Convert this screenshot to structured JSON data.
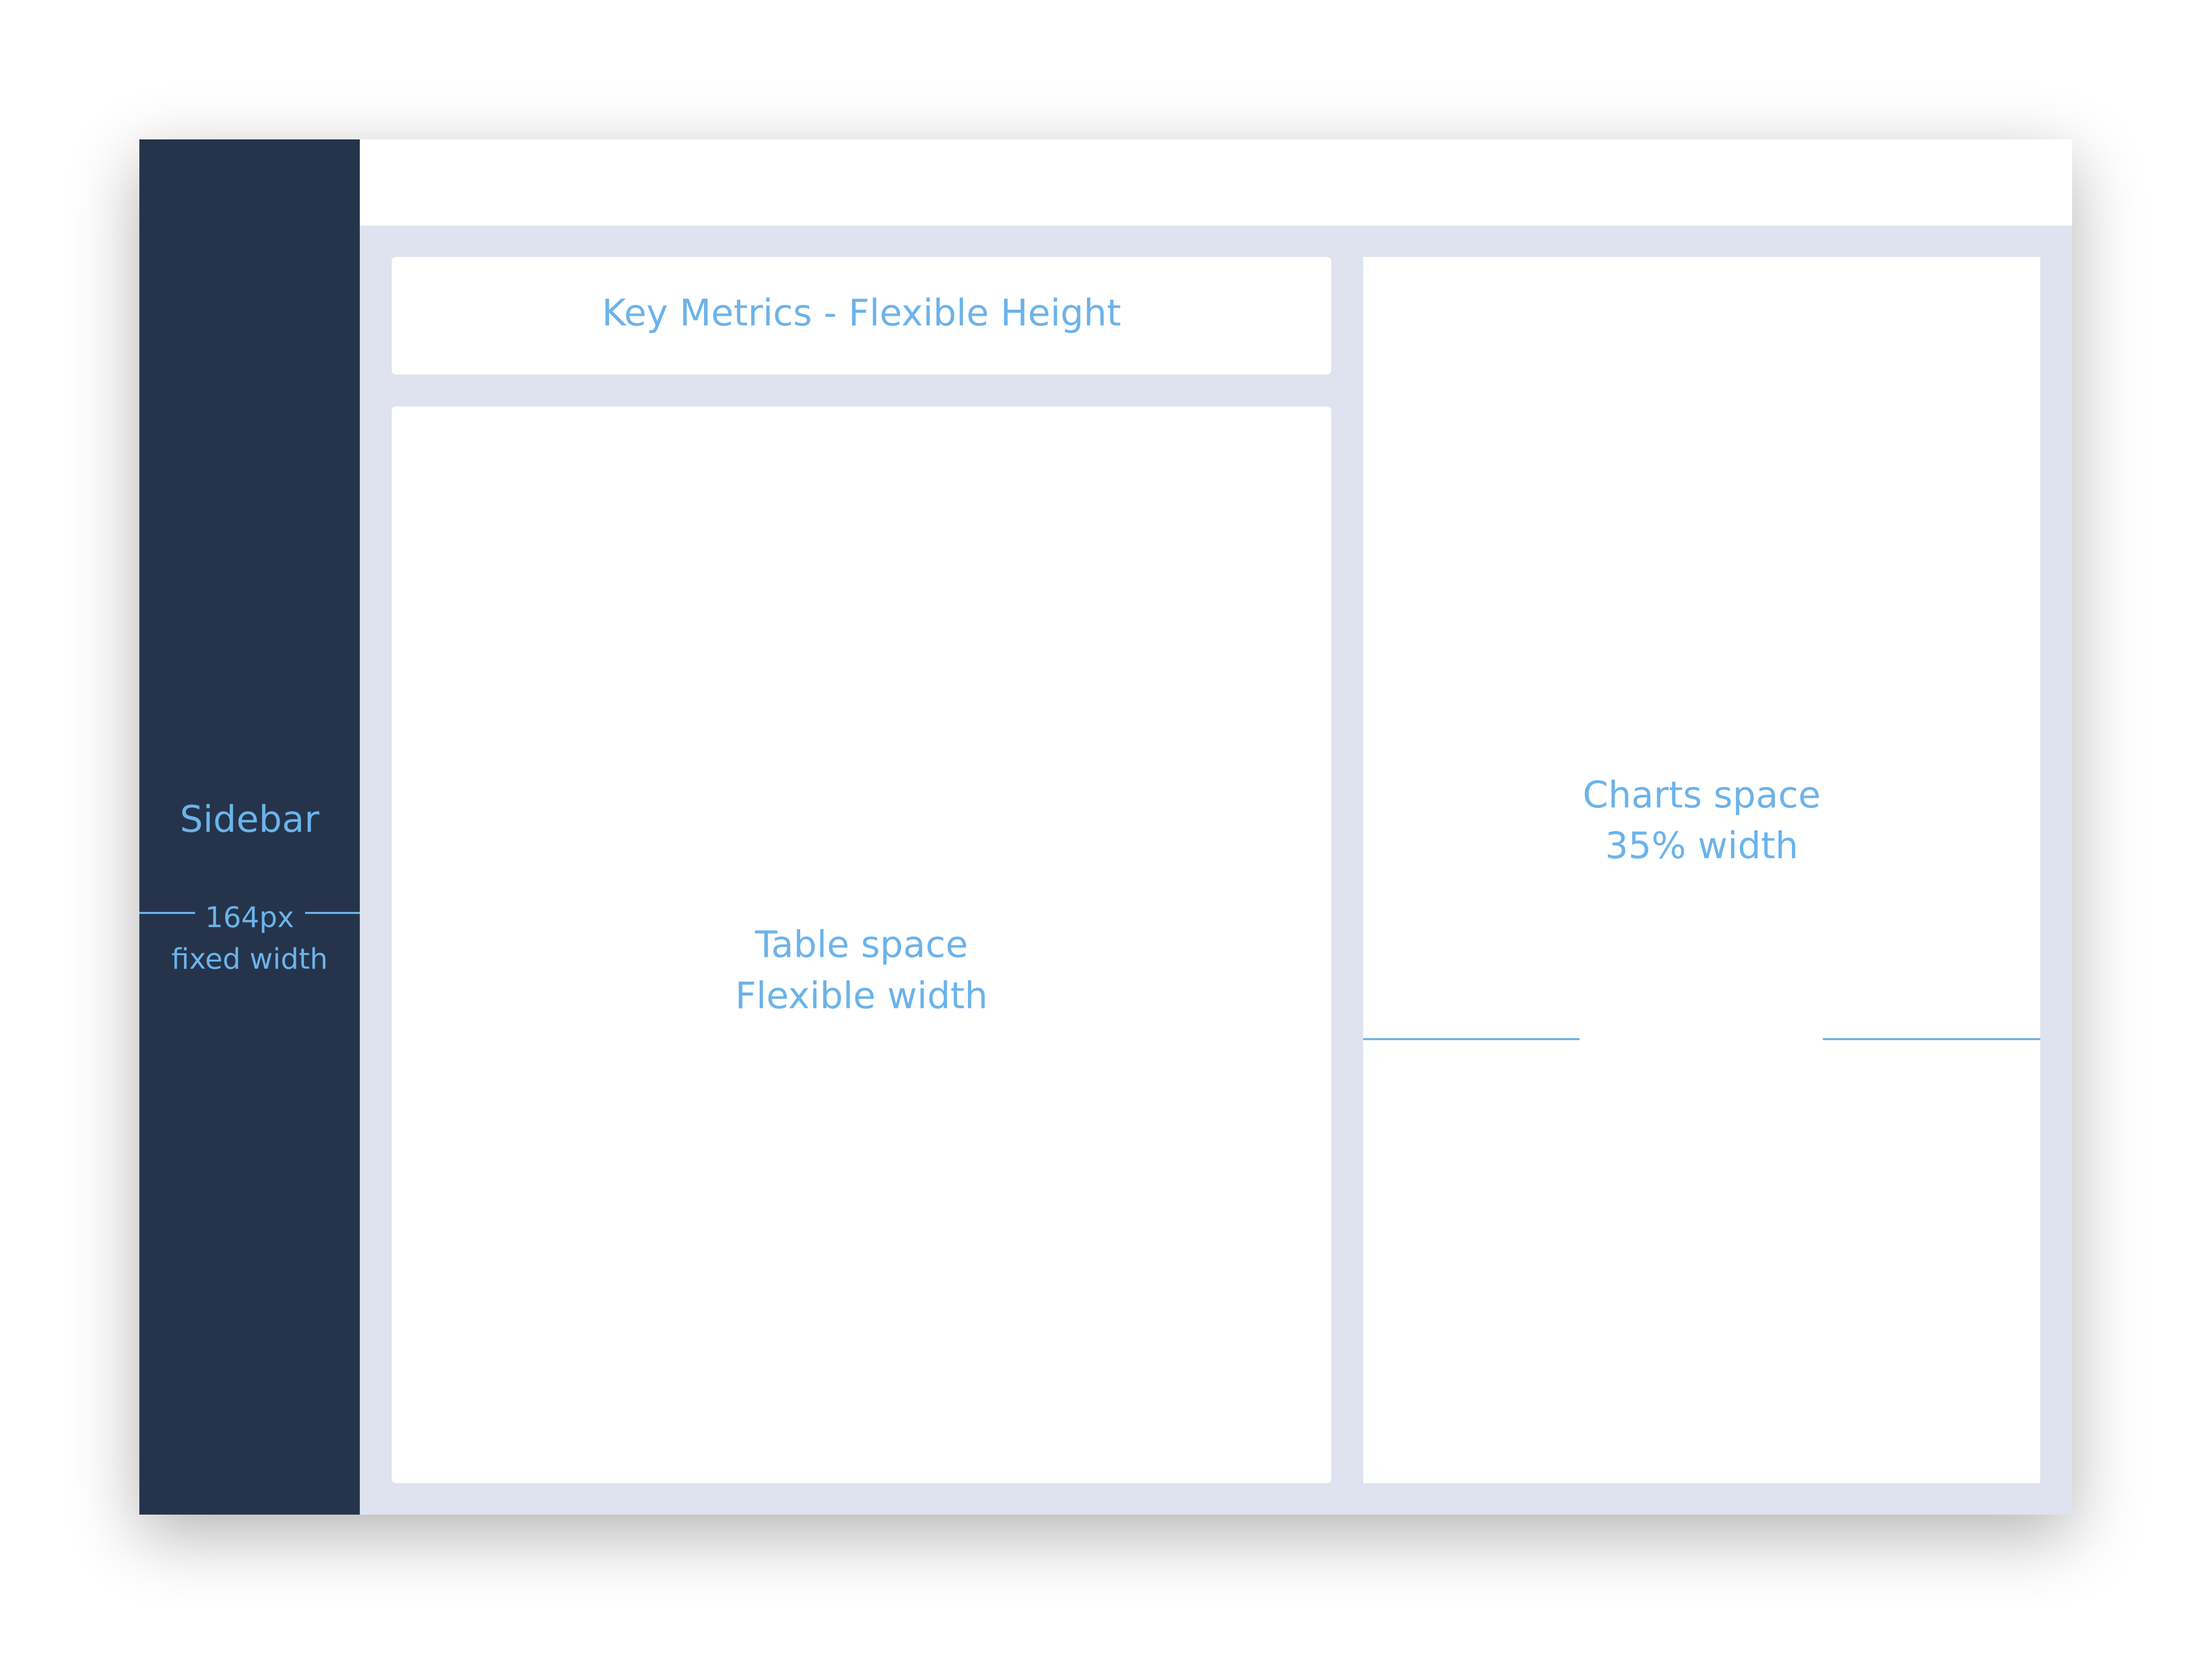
{
  "sidebar": {
    "title": "Sidebar",
    "dimension": "164px",
    "dimension_note": "fixed width"
  },
  "key_metrics": {
    "label": "Key Metrics - Flexible Height"
  },
  "table": {
    "line1": "Table space",
    "line2": "Flexible width"
  },
  "charts": {
    "line1": "Charts space",
    "dimension": "35% width"
  },
  "colors": {
    "sidebar": "#25344b",
    "background": "#dfe3ef",
    "panel": "#ffffff",
    "label": "#6cb3ea"
  }
}
